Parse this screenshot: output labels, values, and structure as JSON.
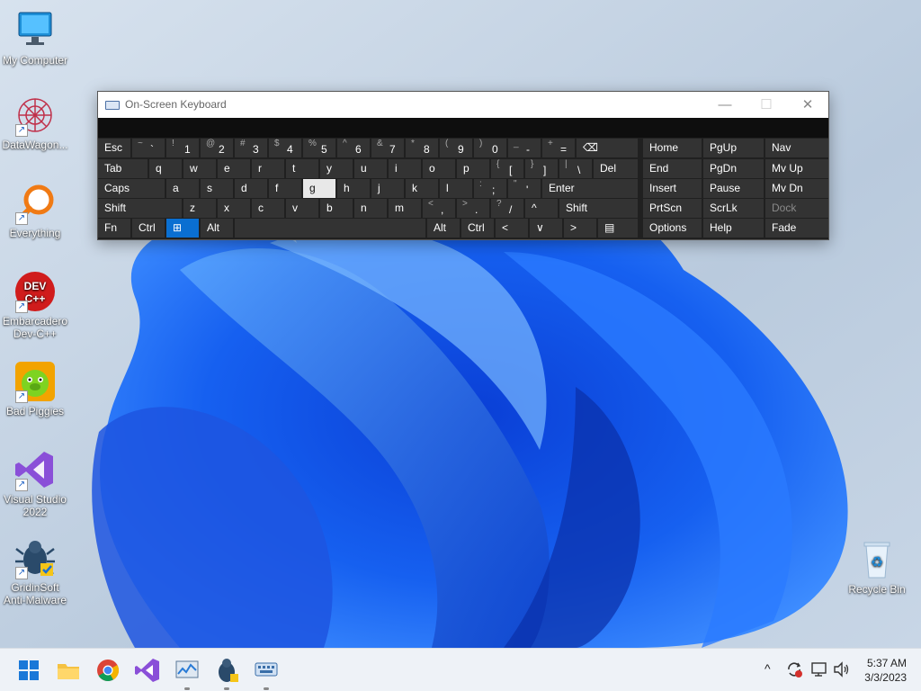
{
  "desktop": {
    "icons": [
      {
        "label": "My Computer"
      },
      {
        "label": "DataWagon..."
      },
      {
        "label": "Everything"
      },
      {
        "label": "Embarcadero\nDev-C++"
      },
      {
        "label": "Bad Piggies"
      },
      {
        "label": "Visual Studio\n2022"
      },
      {
        "label": "GridinSoft\nAnti-Malware"
      },
      {
        "label": "Recycle Bin"
      }
    ]
  },
  "osk": {
    "title": "On-Screen Keyboard",
    "window_controls": {
      "minimize": "—",
      "maximize": "☐",
      "close": "✕"
    },
    "row1": [
      {
        "label": "Esc"
      },
      {
        "shift": "~",
        "main": "`"
      },
      {
        "shift": "!",
        "main": "1"
      },
      {
        "shift": "@",
        "main": "2"
      },
      {
        "shift": "#",
        "main": "3"
      },
      {
        "shift": "$",
        "main": "4"
      },
      {
        "shift": "%",
        "main": "5"
      },
      {
        "shift": "^",
        "main": "6"
      },
      {
        "shift": "&",
        "main": "7"
      },
      {
        "shift": "*",
        "main": "8"
      },
      {
        "shift": "(",
        "main": "9"
      },
      {
        "shift": ")",
        "main": "0"
      },
      {
        "shift": "_",
        "main": "-"
      },
      {
        "shift": "+",
        "main": "="
      },
      {
        "label": "⌫"
      }
    ],
    "row2": [
      {
        "label": "Tab"
      },
      {
        "label": "q"
      },
      {
        "label": "w"
      },
      {
        "label": "e"
      },
      {
        "label": "r"
      },
      {
        "label": "t"
      },
      {
        "label": "y"
      },
      {
        "label": "u"
      },
      {
        "label": "i"
      },
      {
        "label": "o"
      },
      {
        "label": "p"
      },
      {
        "shift": "{",
        "main": "["
      },
      {
        "shift": "}",
        "main": "]"
      },
      {
        "shift": "|",
        "main": "\\"
      },
      {
        "label": "Del"
      }
    ],
    "row3": [
      {
        "label": "Caps"
      },
      {
        "label": "a"
      },
      {
        "label": "s"
      },
      {
        "label": "d"
      },
      {
        "label": "f"
      },
      {
        "label": "g"
      },
      {
        "label": "h"
      },
      {
        "label": "j"
      },
      {
        "label": "k"
      },
      {
        "label": "l"
      },
      {
        "shift": ":",
        "main": ";"
      },
      {
        "shift": "\"",
        "main": "'"
      },
      {
        "label": "Enter"
      }
    ],
    "row4": [
      {
        "label": "Shift"
      },
      {
        "label": "z"
      },
      {
        "label": "x"
      },
      {
        "label": "c"
      },
      {
        "label": "v"
      },
      {
        "label": "b"
      },
      {
        "label": "n"
      },
      {
        "label": "m"
      },
      {
        "shift": "<",
        "main": ","
      },
      {
        "shift": ">",
        "main": "."
      },
      {
        "shift": "?",
        "main": "/"
      },
      {
        "label": "^"
      },
      {
        "label": "Shift"
      }
    ],
    "row5": [
      {
        "label": "Fn"
      },
      {
        "label": "Ctrl"
      },
      {
        "label": "⊞"
      },
      {
        "label": "Alt"
      },
      {
        "label": ""
      },
      {
        "label": "Alt"
      },
      {
        "label": "Ctrl"
      },
      {
        "label": "<"
      },
      {
        "label": "∨"
      },
      {
        "label": ">"
      },
      {
        "label": "▤"
      }
    ],
    "nav": [
      [
        "Home",
        "PgUp",
        "Nav"
      ],
      [
        "End",
        "PgDn",
        "Mv Up"
      ],
      [
        "Insert",
        "Pause",
        "Mv Dn"
      ],
      [
        "PrtScn",
        "ScrLk",
        "Dock"
      ],
      [
        "Options",
        "Help",
        "Fade"
      ]
    ]
  },
  "taskbar": {
    "apps": [
      "start",
      "file-explorer",
      "chrome",
      "visual-studio",
      "task-manager",
      "gridinsoft",
      "on-screen-keyboard"
    ],
    "tray": {
      "chevron": "^"
    },
    "clock": {
      "time": "5:37 AM",
      "date": "3/3/2023"
    }
  }
}
